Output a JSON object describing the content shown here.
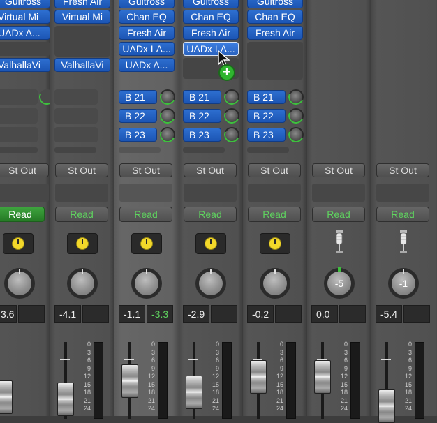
{
  "channels": [
    {
      "inserts": [
        "Guitross",
        "Virtual Mi",
        "UADx A...",
        "",
        "ValhallaVi"
      ],
      "output": "St Out",
      "automation": "Read",
      "automation_active": true,
      "volume": "3.6",
      "peak": ""
    },
    {
      "inserts": [
        "Fresh Air",
        "Virtual Mi",
        "",
        "",
        "ValhallaVi"
      ],
      "output": "St Out",
      "automation": "Read",
      "automation_active": false,
      "volume": "-4.1",
      "peak": ""
    },
    {
      "inserts": [
        "Guitross",
        "Chan EQ",
        "Fresh Air",
        "UADx LA...",
        "UADx A..."
      ],
      "output": "St Out",
      "automation": "Read",
      "automation_active": false,
      "volume": "-1.1",
      "peak": "-3.3",
      "sends": [
        "B 21",
        "B 22",
        "B 23"
      ]
    },
    {
      "inserts": [
        "Guitross",
        "Chan EQ",
        "Fresh Air",
        "UADx LA..."
      ],
      "output": "St Out",
      "automation": "Read",
      "automation_active": false,
      "volume": "-2.9",
      "peak": "",
      "sends": [
        "B 21",
        "B 22",
        "B 23"
      ]
    },
    {
      "inserts": [
        "Guitross",
        "Chan EQ",
        "Fresh Air"
      ],
      "output": "St Out",
      "automation": "Read",
      "automation_active": false,
      "volume": "-0.2",
      "peak": "",
      "sends": [
        "B 21",
        "B 22",
        "B 23"
      ]
    },
    {
      "output": "St Out",
      "automation": "Read",
      "automation_active": false,
      "pan": "-5",
      "volume": "0.0",
      "peak": ""
    },
    {
      "output": "St Out",
      "automation": "Read",
      "automation_active": false,
      "pan": "-1",
      "volume": "-5.4",
      "peak": ""
    }
  ],
  "fader_scale": [
    "0",
    "3",
    "6",
    "9",
    "12",
    "15",
    "18",
    "21",
    "24"
  ],
  "drag_add_icon": "plus-icon",
  "pointer_icon": "arrow-cursor-icon",
  "colors": {
    "slot_blue": "#1c55b4",
    "read_green": "#3ea33e",
    "io_yellow": "#f3d82a"
  }
}
